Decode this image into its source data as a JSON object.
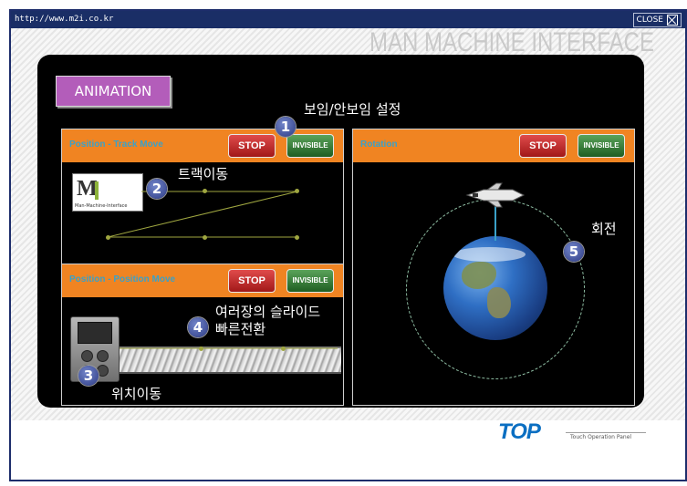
{
  "browser": {
    "url": "http://www.m2i.co.kr",
    "close_label": "CLOSE"
  },
  "brand_watermark": "MAN MACHINE INTERFACE",
  "section_tag": "ANIMATION",
  "panels": {
    "track": {
      "title": "Position - Track Move",
      "stop_label": "STOP",
      "invisible_label": "INVISIBLE"
    },
    "position": {
      "title": "Position - Position Move",
      "stop_label": "STOP",
      "invisible_label": "INVISIBLE"
    },
    "rotation": {
      "title": "Rotation",
      "stop_label": "STOP",
      "invisible_label": "INVISIBLE"
    }
  },
  "annotations": [
    {
      "number": "1",
      "text": "보임/안보임 설정"
    },
    {
      "number": "2",
      "text": "트랙이동"
    },
    {
      "number": "3",
      "text": "위치이동"
    },
    {
      "number": "4",
      "text": "여러장의 슬라이드\n빠른전환"
    },
    {
      "number": "5",
      "text": "회전"
    }
  ],
  "logo": {
    "letters": "M",
    "caption": "Man-Machine-Interface"
  },
  "footer_logo": {
    "name_a": "TO",
    "name_b": "P",
    "tagline": "Touch Operation Panel"
  }
}
